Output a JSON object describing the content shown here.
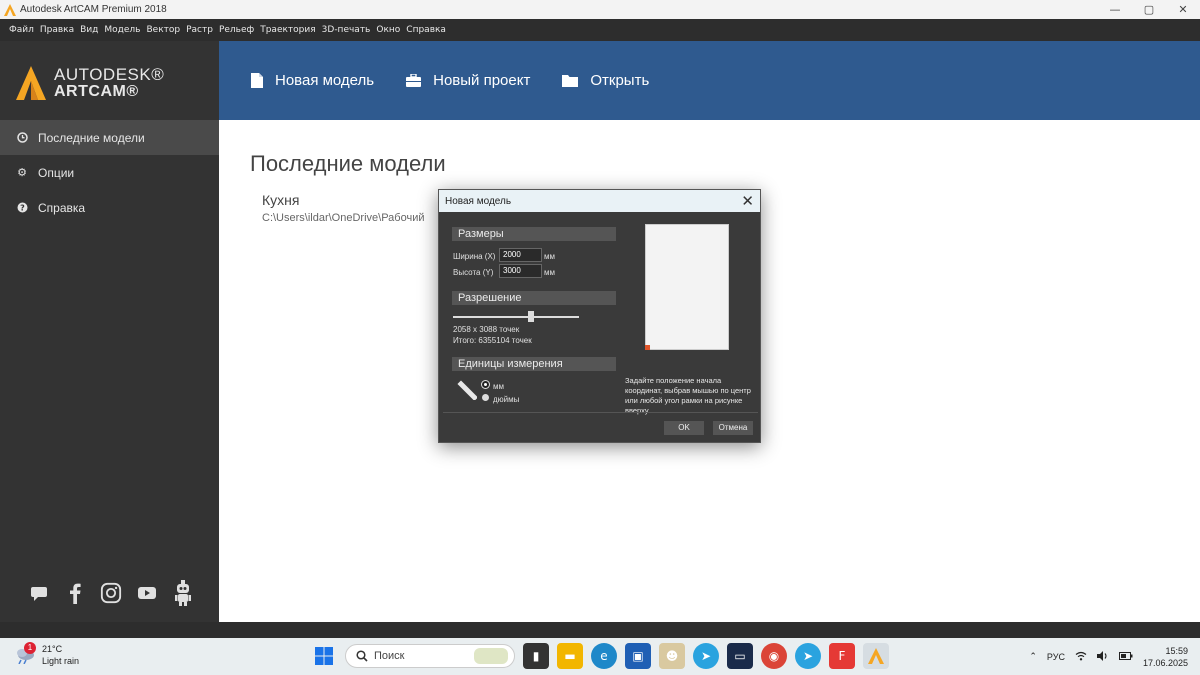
{
  "window": {
    "title": "Autodesk ArtCAM Premium 2018",
    "controls": [
      "—",
      "▢",
      "✕"
    ]
  },
  "menu": [
    "Файл",
    "Правка",
    "Вид",
    "Модель",
    "Вектор",
    "Растр",
    "Рельеф",
    "Траектория",
    "3D-печать",
    "Окно",
    "Справка"
  ],
  "brand": {
    "line1": "AUTODESK®",
    "line2": "ARTCAM®",
    "accent": "#f5a623"
  },
  "sidebar": {
    "items": [
      {
        "label": "Последние модели",
        "icon": "clock-icon",
        "active": true
      },
      {
        "label": "Опции",
        "icon": "gear-icon",
        "active": false
      },
      {
        "label": "Справка",
        "icon": "help-icon",
        "active": false
      }
    ],
    "social": [
      "chat-icon",
      "facebook-icon",
      "instagram-icon",
      "youtube-icon",
      "robot-icon"
    ]
  },
  "header": {
    "color": "#2f5a8f",
    "buttons": [
      {
        "label": "Новая модель",
        "icon": "file-icon"
      },
      {
        "label": "Новый проект",
        "icon": "briefcase-icon"
      },
      {
        "label": "Открыть",
        "icon": "folder-icon"
      }
    ]
  },
  "main": {
    "title": "Последние модели",
    "recent": [
      {
        "name": "Кухня",
        "path": "C:\\Users\\ildar\\OneDrive\\Рабочий"
      }
    ]
  },
  "dialog": {
    "title": "Новая модель",
    "sizes_header": "Размеры",
    "width_label": "Ширина (X)",
    "width_value": "2000",
    "height_label": "Высота (Y)",
    "height_value": "3000",
    "unit": "мм",
    "resolution_header": "Разрешение",
    "resolution_points": "2058 x 3088 точек",
    "resolution_total": "Итого: 6355104 точек",
    "resolution_level": 0.62,
    "units_header": "Единицы измерения",
    "unit_mm": "мм",
    "unit_inch": "дюймы",
    "hint": "Задайте положение начала координат, выбрав мышью по центр или любой угол рамки на рисунке вверху.",
    "ok": "OK",
    "cancel": "Отмена"
  },
  "taskbar": {
    "weather_temp": "21°C",
    "weather_desc": "Light rain",
    "weather_badge": "1",
    "search_placeholder": "Поиск",
    "lang": "РУС",
    "time": "15:59",
    "date": "17.06.2025"
  }
}
